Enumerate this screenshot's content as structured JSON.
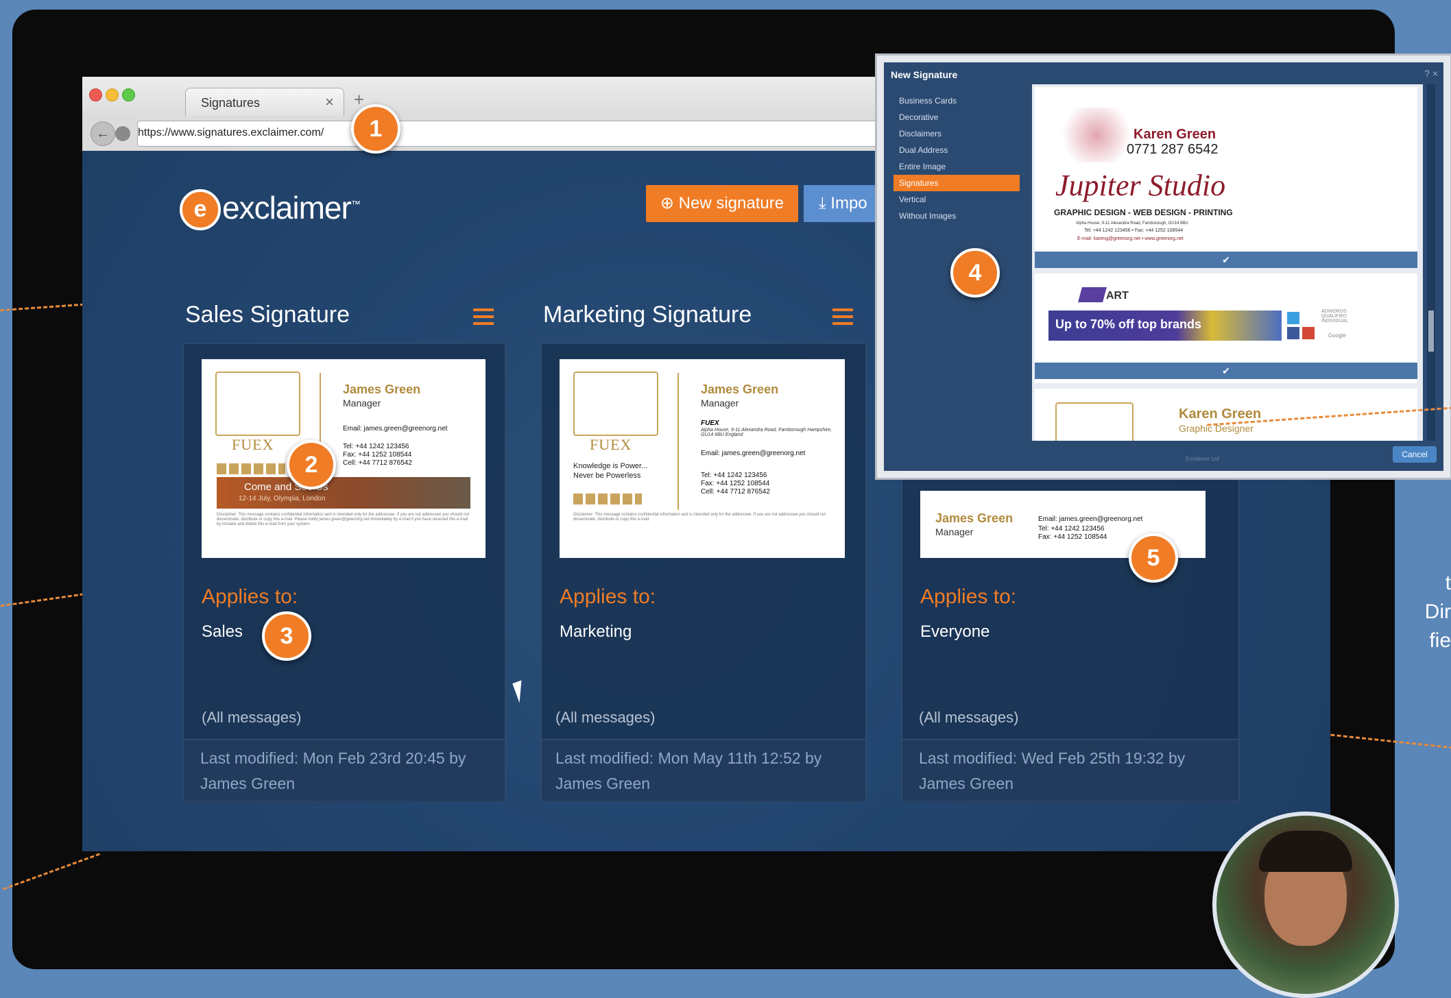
{
  "browser": {
    "tab_title": "Signatures",
    "tab_close": "×",
    "new_tab": "+",
    "url": "https://www.signatures.exclaimer.com/"
  },
  "app": {
    "logo_text": "exclaimer",
    "logo_trademark": "™",
    "new_signature_label": "New signature",
    "import_label": "Impo"
  },
  "signatures": [
    {
      "title": "Sales Signature",
      "preview": {
        "name": "James Green",
        "role": "Manager",
        "company": "FUEX",
        "email": "Email: james.green@greenorg.net",
        "tel": "Tel:   +44 1242 123456",
        "fax": "Fax:  +44 1252 108544",
        "cell": "Cell:  +44 7712 876542",
        "banner_title": "Come and See Us",
        "banner_sub": "12-14 July, Olympia, London",
        "disclaimer": "Disclaimer: This message contains confidential information and is intended only for the addressee. If you are not addressee you should not disseminate, distribute or copy this e-mail. Please notify james.green@greenorg.net immediately by e-mail if you have received this e-mail by mistake and delete this e-mail from your system."
      },
      "applies_label": "Applies to:",
      "applies_value": "Sales",
      "scope": "(All messages)",
      "modified": "Last modified: Mon Feb 23rd 20:45 by James Green"
    },
    {
      "title": "Marketing Signature",
      "preview": {
        "name": "James Green",
        "role": "Manager",
        "company": "FUEX",
        "company_line": "FUEX",
        "address": "Alpha House, 9-11 Alexandra Road, Farnborough Hampshire, GU14 6BU England",
        "tagline_1": "Knowledge is Power...",
        "tagline_2": "Never be Powerless",
        "email": "Email: james.green@greenorg.net",
        "tel": "Tel:   +44 1242 123456",
        "fax": "Fax:  +44 1252 108544",
        "cell": "Cell:  +44 7712 876542",
        "disclaimer": "Disclaimer: This message contains confidential information and is intended only for the addressee. If you are not addressee you should not disseminate, distribute or copy this e-mail."
      },
      "applies_label": "Applies to:",
      "applies_value": "Marketing",
      "scope": "(All messages)",
      "modified": "Last modified: Mon May 11th 12:52 by James Green"
    },
    {
      "title": "",
      "preview": {
        "name": "James Green",
        "role": "Manager",
        "email": "Email: james.green@greenorg.net",
        "tel": "Tel:   +44 1242 123456",
        "fax": "Fax:  +44 1252 108544"
      },
      "applies_label": "Applies to:",
      "applies_value": "Everyone",
      "scope": "(All messages)",
      "modified": "Last modified: Wed Feb 25th 19:32 by James Green"
    }
  ],
  "dialog": {
    "title": "New Signature",
    "controls": "? ×",
    "categories": [
      "Business Cards",
      "Decorative",
      "Disclaimers",
      "Dual Address",
      "Entire Image",
      "Signatures",
      "Vertical",
      "Without Images"
    ],
    "selected_category": "Signatures",
    "template1": {
      "name": "Karen Green",
      "phone": "0771 287 6542",
      "studio": "Jupiter Studio",
      "tagline": "GRAPHIC DESIGN - WEB DESIGN - PRINTING",
      "address": "Alpha House, 9-11 Alexandra Road, Farnborough, GU14 6BU",
      "contact": "Tel: +44 1242 123456 • Fax: +44 1252 108544",
      "email": "E-mail: kareng@greenorg.net • www.greenorg.net"
    },
    "template2": {
      "brand": "ART",
      "promo": "Up to 70% off top brands",
      "badge": "ADWORDS QUALIFIED INDIVIDUAL",
      "google": "Google"
    },
    "template3": {
      "name": "Karen Green",
      "role": "Graphic Designer"
    },
    "check": "✔",
    "cancel_label": "Cancel",
    "footer": "Exclaimer Ltd"
  },
  "badges": [
    "1",
    "2",
    "3",
    "4",
    "5"
  ],
  "side_text": [
    "t",
    "Dir",
    "fie"
  ],
  "colors": {
    "accent": "#f07c25",
    "app_bg": "#1f3f66",
    "page_bg": "#5a86b8"
  }
}
